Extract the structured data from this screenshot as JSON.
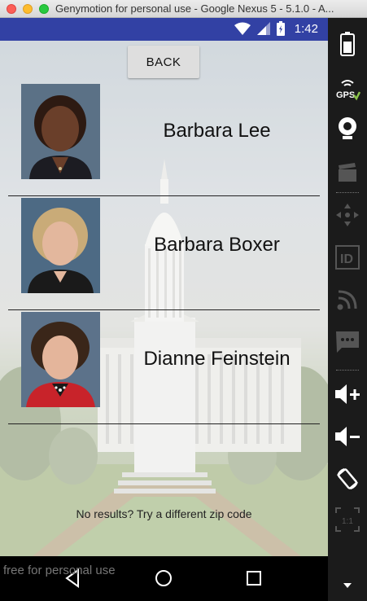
{
  "window": {
    "title": "Genymotion for personal use - Google Nexus 5 - 5.1.0 - A..."
  },
  "statusbar": {
    "time": "1:42"
  },
  "back_button": {
    "label": "BACK"
  },
  "representatives": [
    {
      "name": "Barbara Lee"
    },
    {
      "name": "Barbara Boxer"
    },
    {
      "name": "Dianne Feinstein"
    }
  ],
  "message": "No results?  Try a different zip code",
  "watermark": "free for personal use",
  "side_panel": {
    "gps_label": "GPS",
    "id_label": "ID",
    "ratio_label": "1:1"
  },
  "colors": {
    "statusbar": "#3241a4",
    "side_panel": "#1b1b1b",
    "gps_check": "#8bc34a"
  }
}
